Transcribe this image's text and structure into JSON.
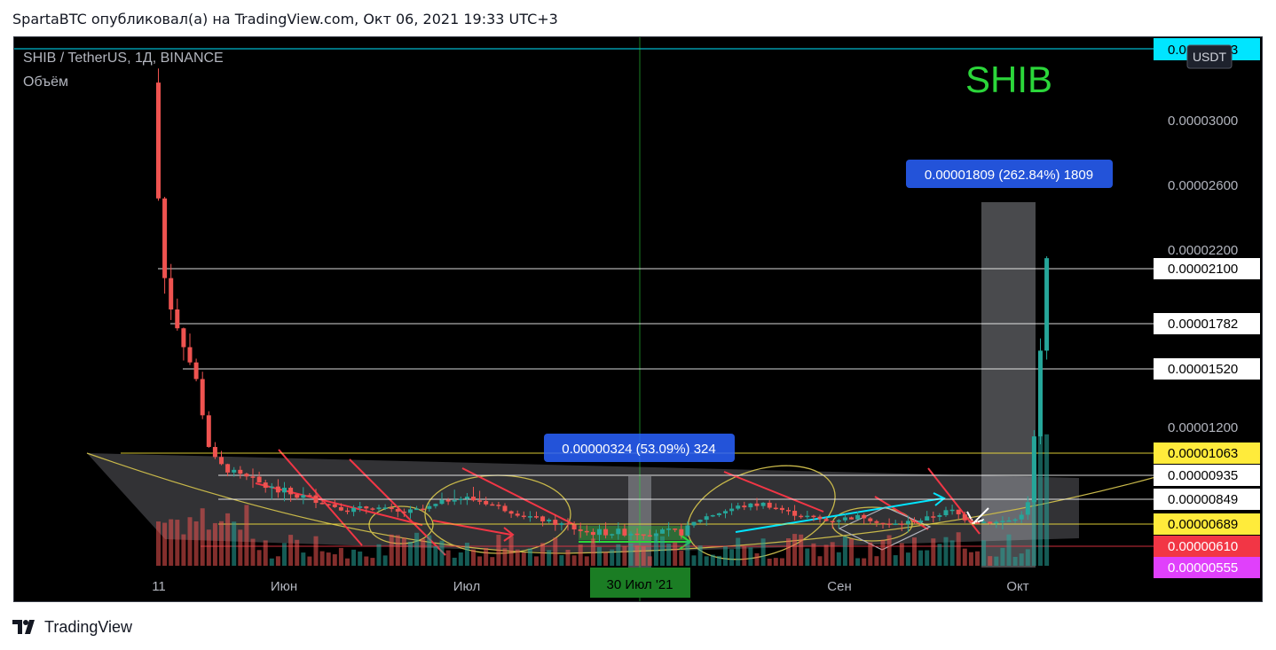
{
  "header": {
    "text": "SpartaBTC опубликовал(а) на TradingView.com, Окт 06, 2021 19:33 UTC+3"
  },
  "footer": {
    "brand": "TradingView"
  },
  "chart_data": {
    "type": "candlestick",
    "symbol_line": "SHIB / TetherUS, 1Д, BINANCE",
    "volume_label": "Объём",
    "watermark": "SHIB",
    "currency_badge": "USDT",
    "x_tick_labels": [
      "11",
      "Июн",
      "Июл",
      "Сен",
      "Окт"
    ],
    "crosshair_date_label": "30 Июл '21",
    "y_ticks": [
      3e-05,
      2.6e-05,
      2.2e-05,
      1.2e-05
    ],
    "y_tick_labels": [
      "0.00003000",
      "0.00002600",
      "0.00002200",
      "0.00001200"
    ],
    "top_line_label": "0.00003463",
    "level_labels": [
      {
        "value": 2.1e-05,
        "text": "0.00002100",
        "bg": "#ffffff",
        "fg": "#000000"
      },
      {
        "value": 1.782e-05,
        "text": "0.00001782",
        "bg": "#ffffff",
        "fg": "#000000"
      },
      {
        "value": 1.52e-05,
        "text": "0.00001520",
        "bg": "#ffffff",
        "fg": "#000000"
      },
      {
        "value": 1.063e-05,
        "text": "0.00001063",
        "bg": "#ffeb3b",
        "fg": "#000000"
      },
      {
        "value": 9.35e-06,
        "text": "0.00000935",
        "bg": "#ffffff",
        "fg": "#000000"
      },
      {
        "value": 8.49e-06,
        "text": "0.00000849",
        "bg": "#ffffff",
        "fg": "#000000"
      },
      {
        "value": 6.89e-06,
        "text": "0.00000689",
        "bg": "#ffeb3b",
        "fg": "#000000"
      },
      {
        "value": 6.1e-06,
        "text": "0.00000610",
        "bg": "#f23645",
        "fg": "#ffffff"
      },
      {
        "value": 5.55e-06,
        "text": "0.00000555",
        "bg": "#e040fb",
        "fg": "#ffffff"
      }
    ],
    "measure_labels": [
      {
        "text": "0.00001809 (262.84%) 1809"
      },
      {
        "text": "0.00000324 (53.09%) 324"
      }
    ],
    "colors": {
      "up": "#26a69a",
      "down": "#ef5350",
      "accent_green": "#2bd63a",
      "cyan": "#00e5ff",
      "yellow": "#ffeb3b",
      "measure": "#2962ff"
    }
  }
}
